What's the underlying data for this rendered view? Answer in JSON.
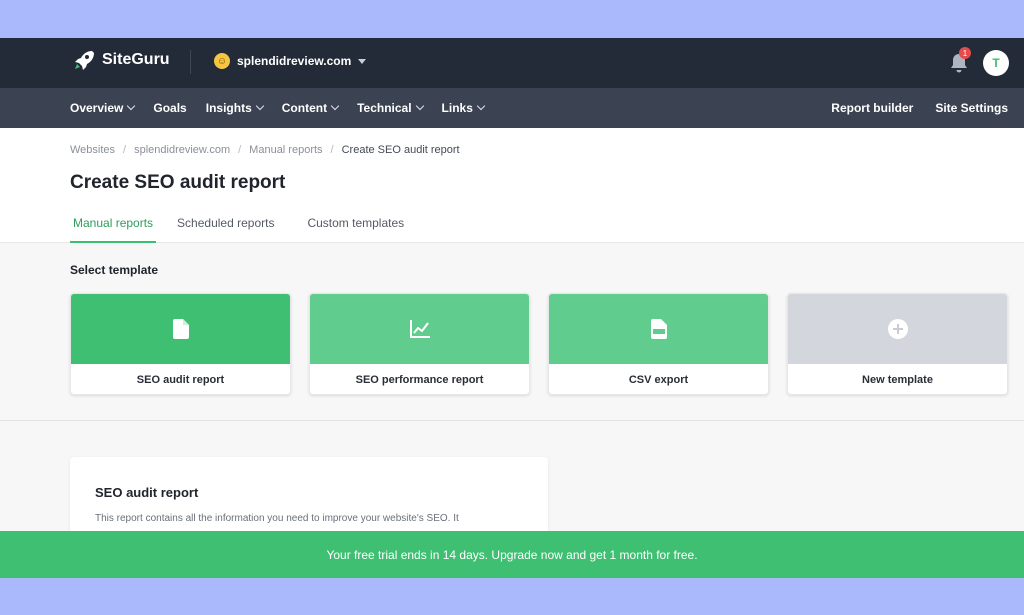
{
  "app": {
    "name": "SiteGuru"
  },
  "site": {
    "domain": "splendidreview.com"
  },
  "notifications": {
    "count": "1"
  },
  "user": {
    "initial": "T"
  },
  "nav": {
    "items": [
      {
        "label": "Overview",
        "dropdown": true
      },
      {
        "label": "Goals",
        "dropdown": false
      },
      {
        "label": "Insights",
        "dropdown": true
      },
      {
        "label": "Content",
        "dropdown": true
      },
      {
        "label": "Technical",
        "dropdown": true
      },
      {
        "label": "Links",
        "dropdown": true
      }
    ],
    "right": {
      "report_builder": "Report builder",
      "site_settings": "Site Settings"
    }
  },
  "breadcrumb": {
    "items": [
      "Websites",
      "splendidreview.com",
      "Manual reports",
      "Create SEO audit report"
    ]
  },
  "page": {
    "title": "Create SEO audit report"
  },
  "tabs": [
    {
      "label": "Manual reports",
      "active": true
    },
    {
      "label": "Scheduled reports",
      "active": false
    },
    {
      "label": "Custom templates",
      "active": false
    }
  ],
  "templates": {
    "section_label": "Select template",
    "cards": [
      {
        "label": "SEO audit report",
        "icon": "document-icon",
        "color": "#3fbf72",
        "selected": true
      },
      {
        "label": "SEO performance report",
        "icon": "line-chart-icon",
        "color": "#60cc8e"
      },
      {
        "label": "CSV export",
        "icon": "csv-file-icon",
        "color": "#60cc8e"
      },
      {
        "label": "New template",
        "icon": "plus-circle-icon",
        "color": "#d4d6dd"
      }
    ]
  },
  "detail": {
    "title": "SEO audit report",
    "description": "This report contains all the information you need to improve your website's SEO. It"
  },
  "banner": {
    "text": "Your free trial ends in 14 days. Upgrade now and get 1 month for free."
  },
  "colors": {
    "accent": "#3fbf72",
    "topbar": "#232a38",
    "navbar": "#3b4252",
    "outer": "#aab8fc"
  }
}
